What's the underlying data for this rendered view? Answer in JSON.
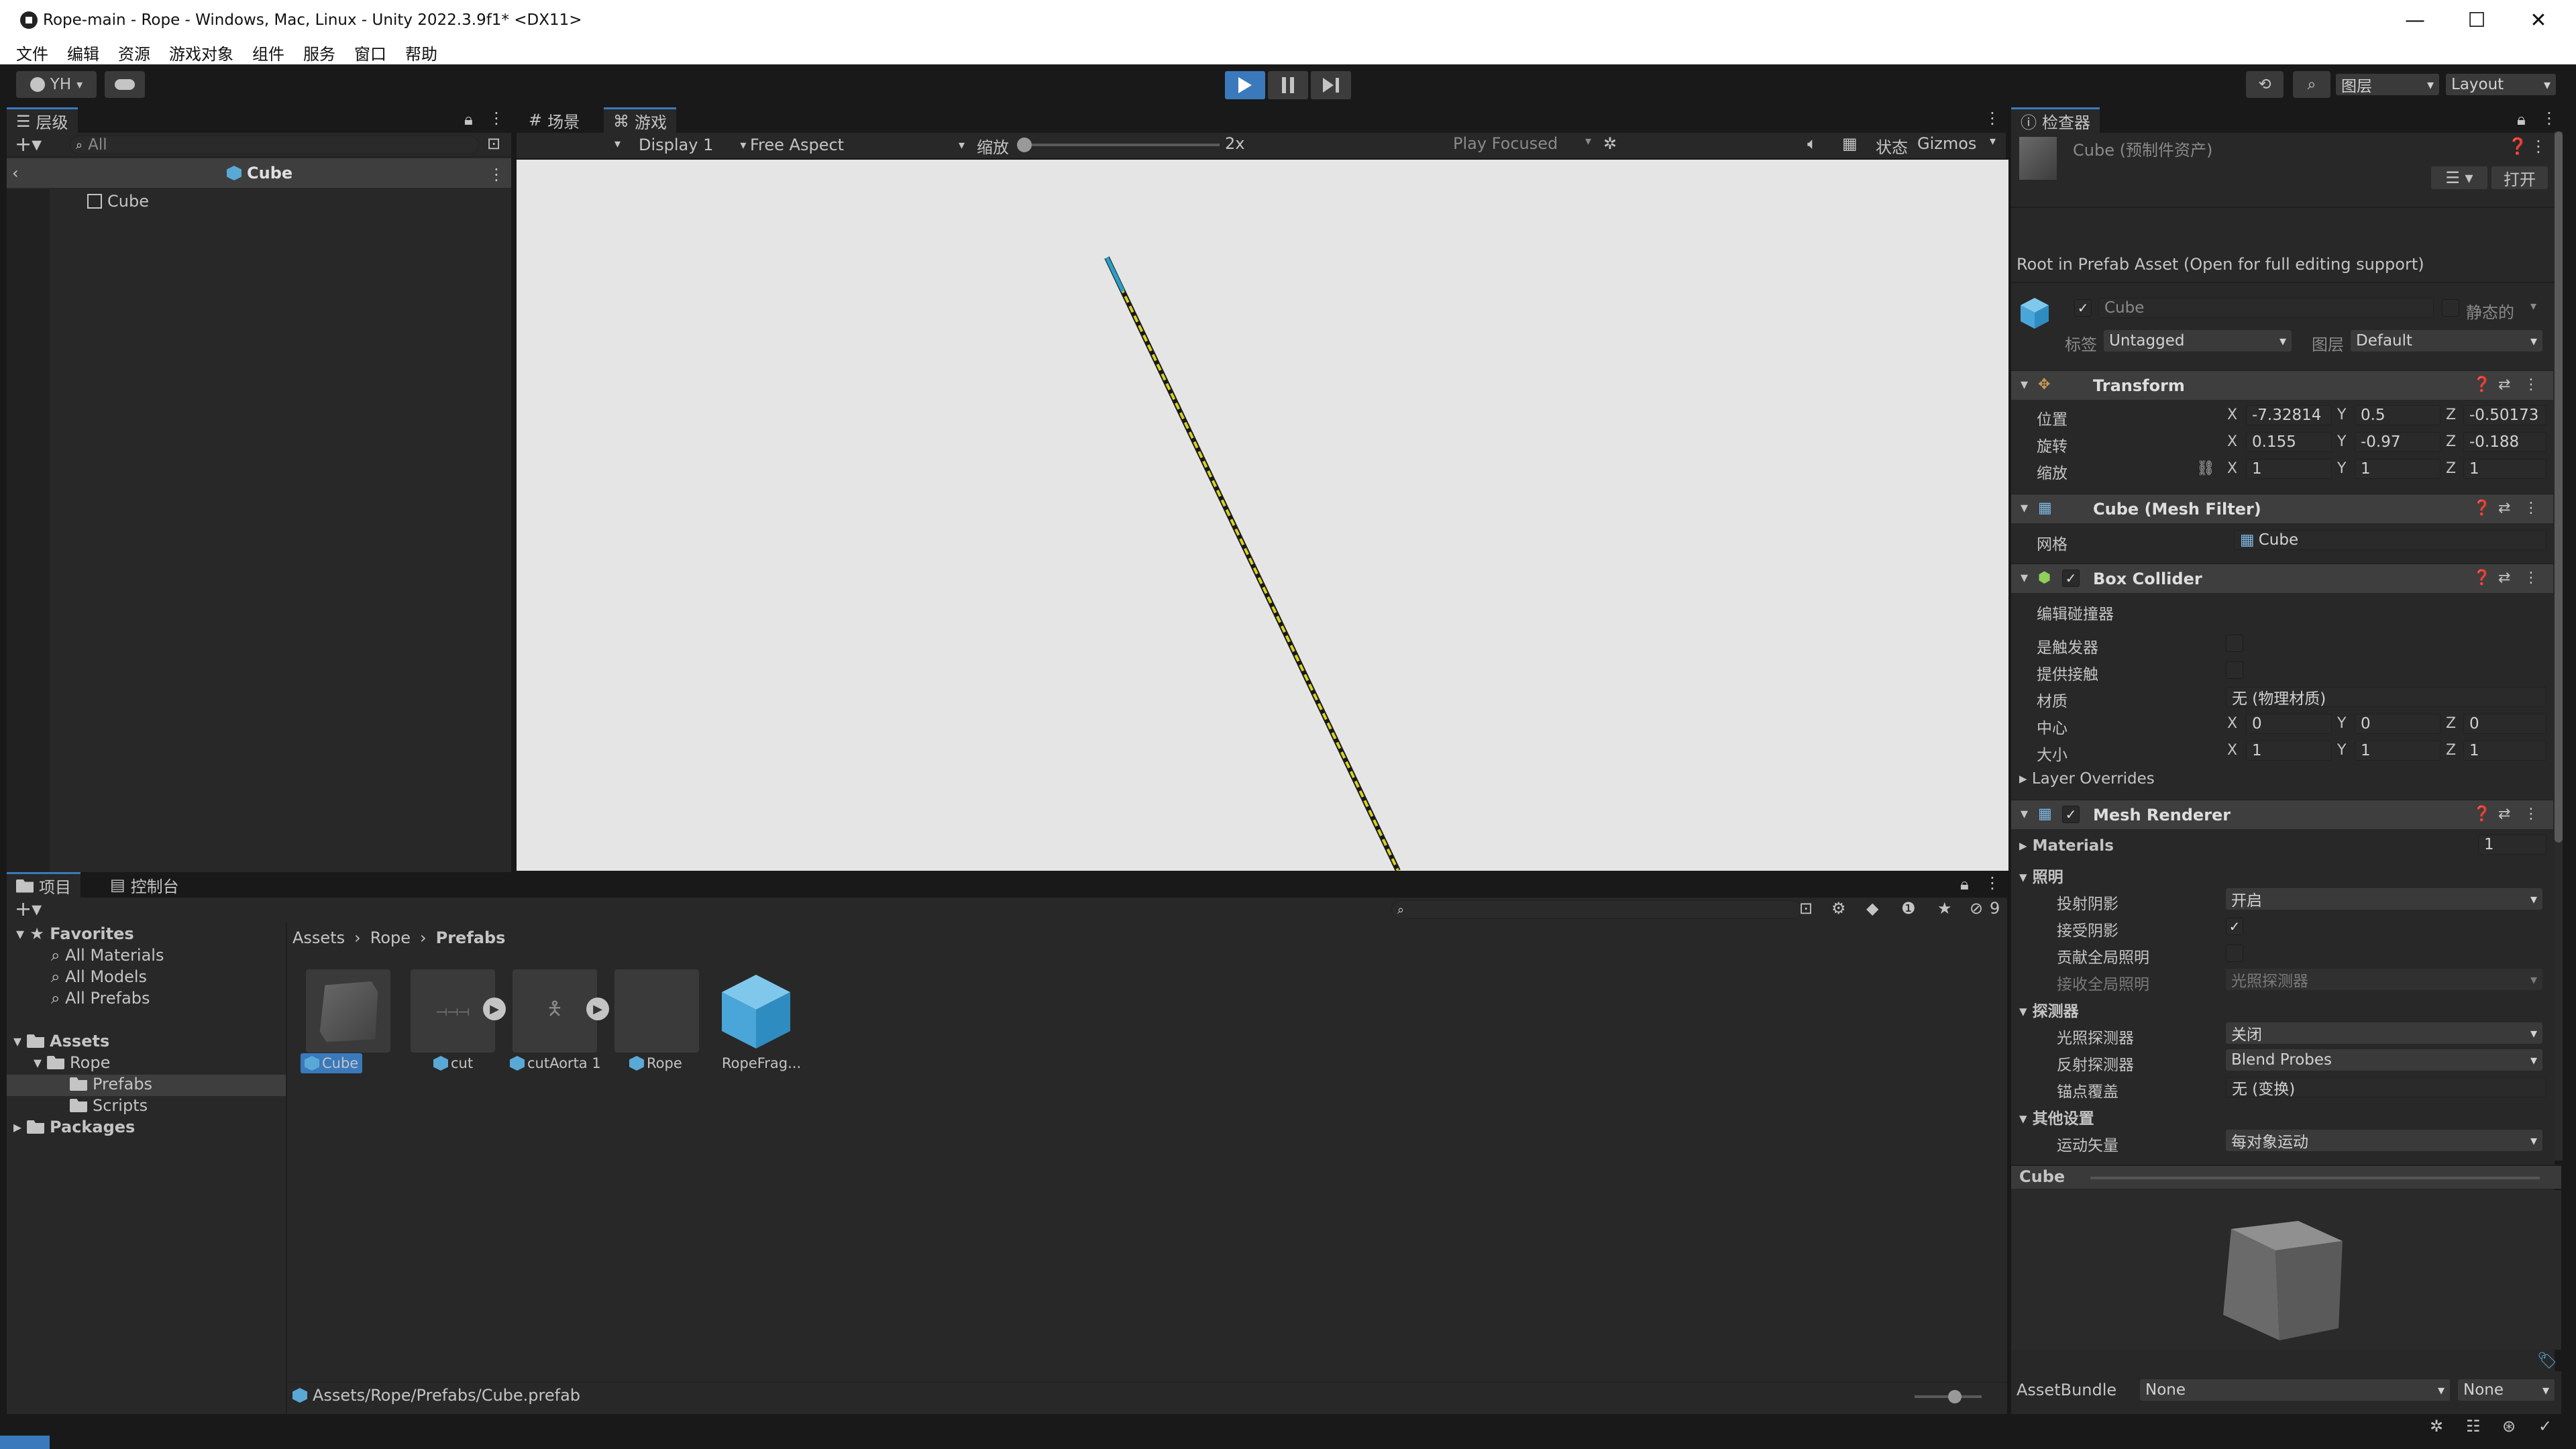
{
  "window": {
    "title": "Rope-main - Rope - Windows, Mac, Linux - Unity 2022.3.9f1* <DX11>",
    "minimize": "—",
    "maximize": "☐",
    "close": "✕"
  },
  "menu": [
    "文件",
    "编辑",
    "资源",
    "游戏对象",
    "组件",
    "服务",
    "窗口",
    "帮助"
  ],
  "toolbar": {
    "account": "YH",
    "layers": "图层",
    "layout": "Layout",
    "play_state": "playing",
    "accent": "#3a79bb"
  },
  "hierarchy": {
    "tab": "层级",
    "search_placeholder": "All",
    "scene_object": "Cube",
    "child": "Cube"
  },
  "game": {
    "tab_scene": "场景",
    "tab_game": "游戏",
    "display": "Display 1",
    "aspect": "Free Aspect",
    "scale_label": "缩放",
    "scale_value": "2x",
    "play_mode": "Play Focused",
    "stats": "状态",
    "gizmos": "Gizmos",
    "background": "#e5e5e5",
    "rope_color": "#d7d21b"
  },
  "project": {
    "tab_project": "项目",
    "tab_console": "控制台",
    "favorites": "Favorites",
    "fav_items": [
      "All Materials",
      "All Models",
      "All Prefabs"
    ],
    "assets": "Assets",
    "rope": "Rope",
    "prefabs": "Prefabs",
    "scripts": "Scripts",
    "packages": "Packages",
    "breadcrumb": [
      "Assets",
      "Rope",
      "Prefabs"
    ],
    "hidden_count": "9",
    "items": [
      {
        "label": "Cube",
        "selected": true
      },
      {
        "label": "cut",
        "selected": false
      },
      {
        "label": "cutAorta 1",
        "selected": false
      },
      {
        "label": "Rope",
        "selected": false
      },
      {
        "label": "RopeFrag...",
        "selected": false
      }
    ],
    "status_path": "Assets/Rope/Prefabs/Cube.prefab"
  },
  "inspector": {
    "tab": "检查器",
    "asset_name": "Cube (预制件资产)",
    "open": "打开",
    "root_notice": "Root in Prefab Asset (Open for full editing support)",
    "object_name": "Cube",
    "static": "静态的",
    "tag_label": "标签",
    "tag_value": "Untagged",
    "layer_label": "图层",
    "layer_value": "Default",
    "transform": {
      "title": "Transform",
      "position_label": "位置",
      "rotation_label": "旋转",
      "scale_label": "缩放",
      "position": {
        "x": "-7.32814",
        "y": "0.5",
        "z": "-0.50173"
      },
      "rotation": {
        "x": "0.155",
        "y": "-0.97",
        "z": "-0.188"
      },
      "scale": {
        "x": "1",
        "y": "1",
        "z": "1"
      }
    },
    "mesh_filter": {
      "title": "Cube (Mesh Filter)",
      "mesh_label": "网格",
      "mesh_value": "Cube"
    },
    "box_collider": {
      "title": "Box Collider",
      "edit": "编辑碰撞器",
      "is_trigger": "是触发器",
      "provides_contacts": "提供接触",
      "material_label": "材质",
      "material_value": "无 (物理材质)",
      "center_label": "中心",
      "size_label": "大小",
      "center": {
        "x": "0",
        "y": "0",
        "z": "0"
      },
      "size": {
        "x": "1",
        "y": "1",
        "z": "1"
      },
      "layer_overrides": "Layer Overrides"
    },
    "mesh_renderer": {
      "title": "Mesh Renderer",
      "materials": "Materials",
      "materials_count": "1",
      "lighting": "照明",
      "cast_shadows": "投射阴影",
      "cast_shadows_value": "开启",
      "receive_shadows": "接受阴影",
      "contribute_gi": "贡献全局照明",
      "receive_gi": "接收全局照明",
      "receive_gi_value": "光照探测器",
      "probes": "探测器",
      "light_probes": "光照探测器",
      "light_probes_value": "关闭",
      "reflection_probes": "反射探测器",
      "reflection_probes_value": "Blend Probes",
      "anchor_override": "锚点覆盖",
      "anchor_override_value": "无 (变换)",
      "additional": "其他设置",
      "motion_vectors": "运动矢量",
      "motion_vectors_value": "每对象运动"
    },
    "preview_title": "Cube",
    "assetbundle_label": "AssetBundle",
    "assetbundle_value": "None",
    "assetbundle_variant": "None"
  }
}
